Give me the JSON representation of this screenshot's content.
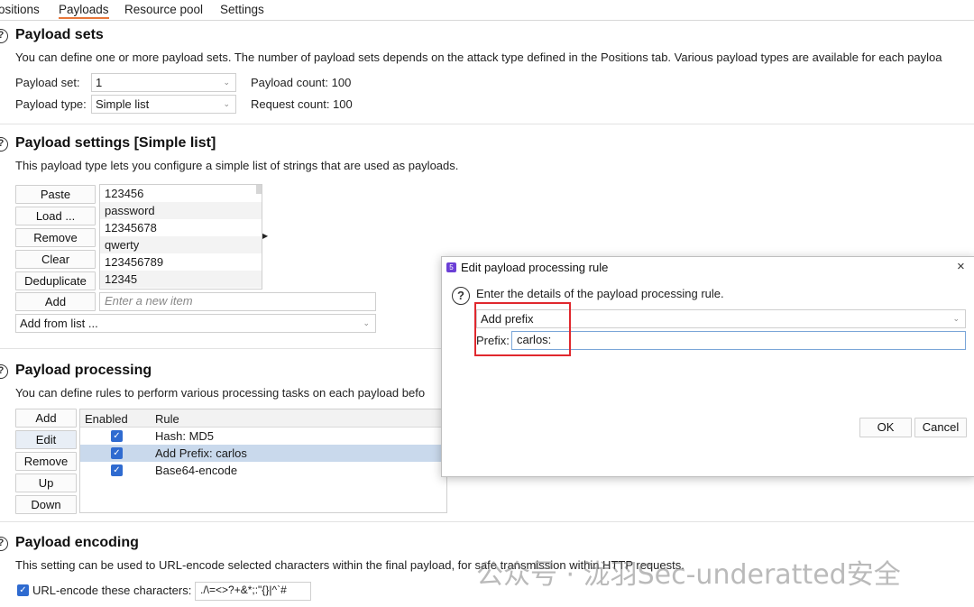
{
  "tabs": [
    {
      "label": "ositions"
    },
    {
      "label": "Payloads"
    },
    {
      "label": "Resource pool"
    },
    {
      "label": "Settings"
    }
  ],
  "payload_sets": {
    "title": "Payload sets",
    "description": "You can define one or more payload sets. The number of payload sets depends on the attack type defined in the Positions tab. Various payload types are available for each payloa",
    "set_label": "Payload set:",
    "set_value": "1",
    "type_label": "Payload type:",
    "type_value": "Simple list",
    "payload_count": "Payload count: 100",
    "request_count": "Request count: 100"
  },
  "payload_settings": {
    "title": "Payload settings [Simple list]",
    "description": "This payload type lets you configure a simple list of strings that are used as payloads.",
    "buttons": {
      "paste": "Paste",
      "load": "Load ...",
      "remove": "Remove",
      "clear": "Clear",
      "deduplicate": "Deduplicate",
      "add": "Add"
    },
    "items": [
      "123456",
      "password",
      "12345678",
      "qwerty",
      "123456789",
      "12345"
    ],
    "new_item_placeholder": "Enter a new item",
    "add_from_list": "Add from list ..."
  },
  "payload_processing": {
    "title": "Payload processing",
    "description": "You can define rules to perform various processing tasks on each payload befo",
    "buttons": {
      "add": "Add",
      "edit": "Edit",
      "remove": "Remove",
      "up": "Up",
      "down": "Down"
    },
    "columns": {
      "enabled": "Enabled",
      "rule": "Rule"
    },
    "rules": [
      {
        "enabled": true,
        "rule": "Hash: MD5",
        "selected": false
      },
      {
        "enabled": true,
        "rule": "Add Prefix: carlos",
        "selected": true
      },
      {
        "enabled": true,
        "rule": "Base64-encode",
        "selected": false
      }
    ]
  },
  "payload_encoding": {
    "title": "Payload encoding",
    "description": "This setting can be used to URL-encode selected characters within the final payload, for safe transmission within HTTP requests.",
    "checkbox_label": "URL-encode these characters:",
    "checkbox_checked": true,
    "characters": "./\\=<>?+&*;:\"{}|^`#"
  },
  "dialog": {
    "title": "Edit payload processing rule",
    "close_glyph": "×",
    "logo_glyph": "5",
    "prompt": "Enter the details of the payload processing rule.",
    "rule_type": "Add prefix",
    "prefix_label": "Prefix:",
    "prefix_value": "carlos:",
    "ok": "OK",
    "cancel": "Cancel"
  },
  "watermark": "公众号 · 泷羽Sec-underatted安全",
  "colors": {
    "accent_tab": "#e8773a",
    "highlight_box": "#e0282e",
    "checkbox": "#2f6bd0",
    "selected_row": "#c9d9ec"
  }
}
